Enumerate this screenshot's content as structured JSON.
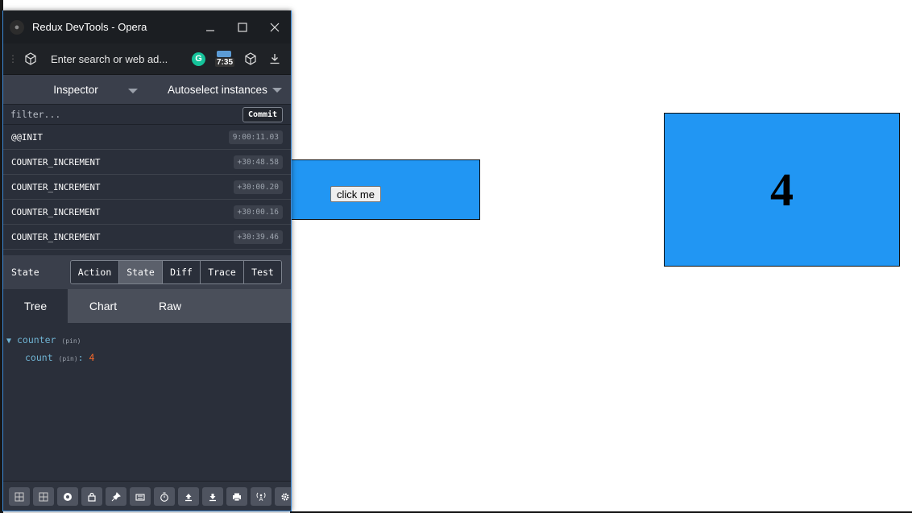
{
  "window": {
    "title": "Redux DevTools - Opera",
    "address_placeholder": "Enter search or web ad...",
    "extension_badge": "7:35"
  },
  "inspector": {
    "monitor": "Inspector",
    "instances": "Autoselect instances"
  },
  "filter": {
    "placeholder": "filter...",
    "commit_label": "Commit"
  },
  "actions": [
    {
      "name": "@@INIT",
      "time": "9:00:11.03"
    },
    {
      "name": "COUNTER_INCREMENT",
      "time": "+30:48.58"
    },
    {
      "name": "COUNTER_INCREMENT",
      "time": "+30:00.20"
    },
    {
      "name": "COUNTER_INCREMENT",
      "time": "+30:00.16"
    },
    {
      "name": "COUNTER_INCREMENT",
      "time": "+30:39.46"
    }
  ],
  "state_panel": {
    "label": "State",
    "tabs": [
      "Action",
      "State",
      "Diff",
      "Trace",
      "Test"
    ],
    "active_tab": "State"
  },
  "view_tabs": {
    "items": [
      "Tree",
      "Chart",
      "Raw"
    ],
    "active": "Tree"
  },
  "tree": {
    "root_key": "counter",
    "root_pin": "(pin)",
    "child_key": "count",
    "child_pin": "(pin)",
    "child_value": "4"
  },
  "bottom_toolbar": {
    "icons": [
      "dock-left-icon",
      "dock-bottom-icon",
      "record-icon",
      "lock-icon",
      "pin-icon",
      "keyboard-icon",
      "timer-icon",
      "upload-icon",
      "download-icon",
      "print-icon",
      "remote-icon",
      "settings-icon"
    ]
  },
  "app": {
    "button_label": "click me",
    "count_value": "4",
    "box_color": "#2196f3"
  }
}
